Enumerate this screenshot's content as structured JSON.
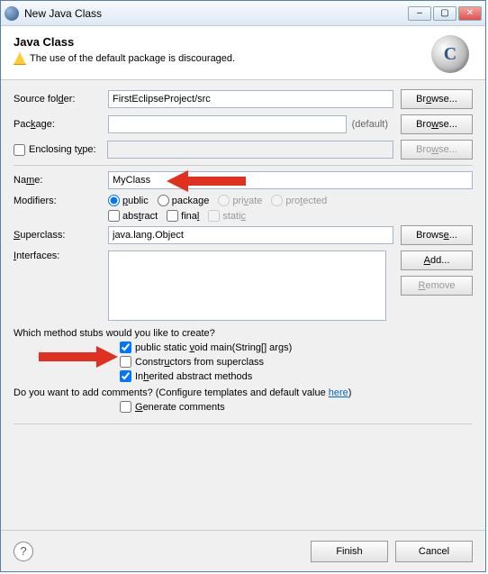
{
  "window": {
    "title": "New Java Class"
  },
  "header": {
    "heading": "Java Class",
    "warning": "The use of the default package is discouraged."
  },
  "form": {
    "sourceFolder": {
      "label": "Source folder:",
      "value": "FirstEclipseProject/src",
      "button": "Browse..."
    },
    "package": {
      "label": "Package:",
      "value": "",
      "defaultText": "(default)",
      "button": "Browse..."
    },
    "enclosing": {
      "label": "Enclosing type:",
      "value": "",
      "button": "Browse..."
    },
    "name": {
      "label": "Name:",
      "value": "MyClass"
    },
    "modifiers": {
      "label": "Modifiers:",
      "access": {
        "public": "public",
        "package": "package",
        "private": "private",
        "protected": "protected"
      },
      "flags": {
        "abstract": "abstract",
        "final": "final",
        "static": "static"
      }
    },
    "superclass": {
      "label": "Superclass:",
      "value": "java.lang.Object",
      "button": "Browse..."
    },
    "interfaces": {
      "label": "Interfaces:",
      "add": "Add...",
      "remove": "Remove"
    },
    "stubsQuestion": "Which method stubs would you like to create?",
    "stubs": {
      "main": "public static void main(String[] args)",
      "constructors": "Constructors from superclass",
      "inherited": "Inherited abstract methods"
    },
    "commentsQuestion": "Do you want to add comments? (Configure templates and default value ",
    "commentsLink": "here",
    "commentsClose": ")",
    "generateComments": "Generate comments"
  },
  "footer": {
    "finish": "Finish",
    "cancel": "Cancel"
  }
}
